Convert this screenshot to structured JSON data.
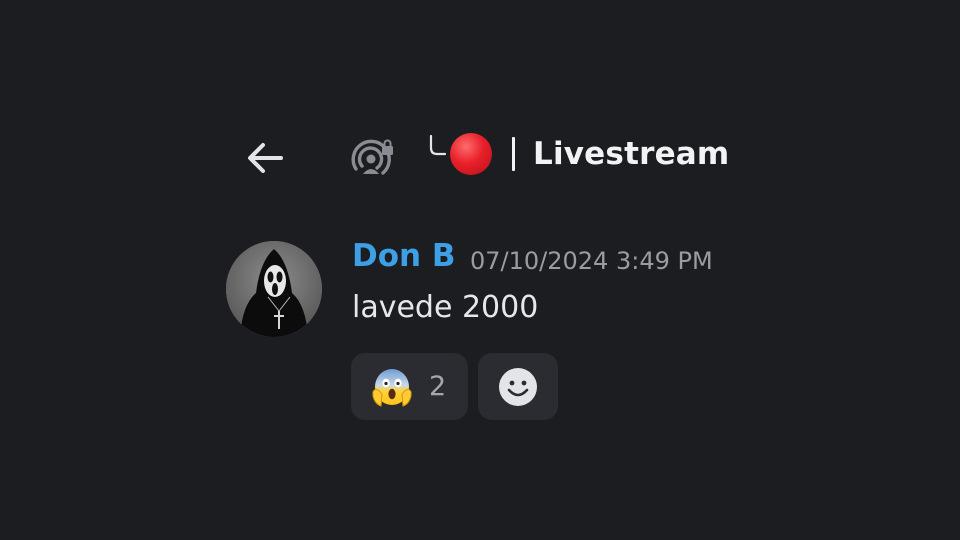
{
  "header": {
    "back_icon": "arrow-left-icon",
    "channel_icon": "stage-channel-locked-icon",
    "channel_prefix_icon": "thread-hook-icon",
    "channel_emoji": "red-circle",
    "channel_name": "Livestream"
  },
  "message": {
    "author": "Don B",
    "timestamp": "07/10/2024 3:49 PM",
    "content": "lavede 2000",
    "author_color": "#3d9fe6"
  },
  "reactions": [
    {
      "emoji": "face-screaming-in-fear",
      "count": "2"
    }
  ],
  "add_reaction": {
    "icon": "smiley-add-reaction-icon"
  },
  "colors": {
    "background": "#1c1d21",
    "pill": "#2b2c31",
    "text": "#f2f3f5",
    "muted": "#9a9ca3",
    "red_dot": "#e8202a"
  }
}
